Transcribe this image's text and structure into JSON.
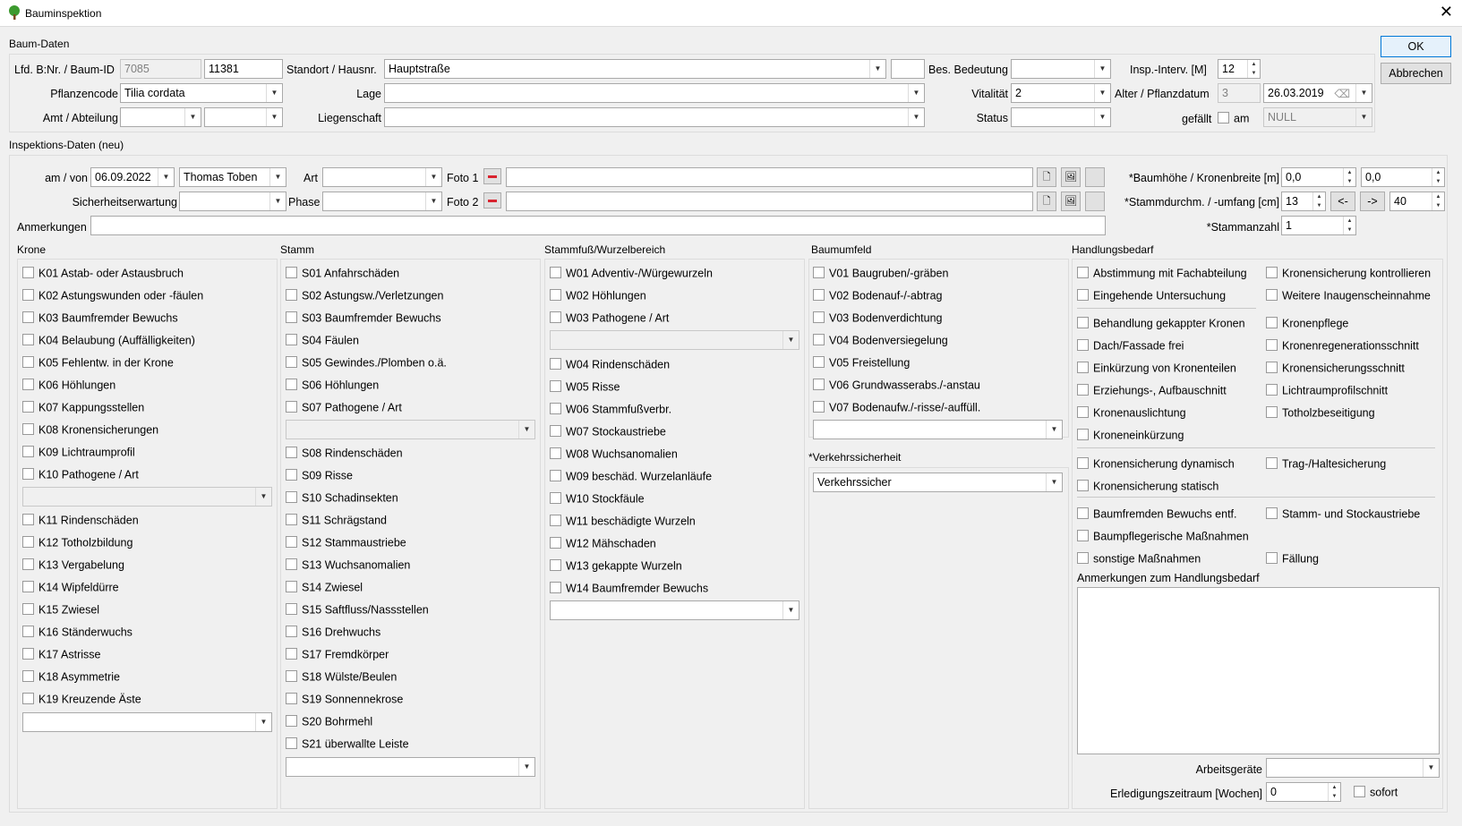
{
  "window": {
    "title": "Bauminspektion",
    "close": "✕"
  },
  "buttons": {
    "ok": "OK",
    "cancel": "Abbrechen"
  },
  "baum": {
    "section": "Baum-Daten",
    "lfd_label": "Lfd. B:Nr. / Baum-ID",
    "lfd_nr": "7085",
    "baum_id": "11381",
    "standort_label": "Standort / Hausnr.",
    "standort": "Hauptstraße",
    "hausnr": "",
    "bes_label": "Bes. Bedeutung",
    "bes": "",
    "insp_label": "Insp.-Interv. [M]",
    "insp": "12",
    "pflanz_label": "Pflanzencode",
    "pflanz": "Tilia cordata",
    "lage_label": "Lage",
    "lage": "",
    "vital_label": "Vitalität",
    "vital": "2",
    "alter_label": "Alter / Pflanzdatum",
    "alter": "3",
    "pflanzdatum": "26.03.2019",
    "amt_label": "Amt / Abteilung",
    "amt": "",
    "abteilung": "",
    "liegen_label": "Liegenschaft",
    "liegen": "",
    "status_label": "Status",
    "status": "",
    "gefaellt_label": "gefällt",
    "am_label": "am",
    "am_value": "NULL"
  },
  "insp": {
    "section": "Inspektions-Daten (neu)",
    "am_label": "am / von",
    "date": "06.09.2022",
    "inspector": "Thomas Toben",
    "art_label": "Art",
    "art": "",
    "foto1_label": "Foto 1",
    "foto1": "",
    "foto2_label": "Foto 2",
    "foto2": "",
    "sicher_label": "Sicherheitserwartung",
    "sicher": "",
    "phase_label": "Phase",
    "phase": "",
    "anm_label": "Anmerkungen",
    "anm": "",
    "hoehe_label": "*Baumhöhe / Kronenbreite [m]",
    "hoehe": "0,0",
    "breite": "0,0",
    "stamm_label": "*Stammdurchm. / -umfang [cm]",
    "durchm": "13",
    "umfang": "40",
    "btn_left": "<-",
    "btn_right": "->",
    "anzahl_label": "*Stammanzahl",
    "anzahl": "1"
  },
  "krone": {
    "title": "Krone",
    "items": [
      "K01 Astab- oder Astausbruch",
      "K02 Astungswunden oder -fäulen",
      "K03 Baumfremder Bewuchs",
      "K04 Belaubung (Auffälligkeiten)",
      "K05 Fehlentw. in der Krone",
      "K06 Höhlungen",
      "K07 Kappungsstellen",
      "K08 Kronensicherungen",
      "K09 Lichtraumprofil",
      "K10 Pathogene / Art",
      "K11 Rindenschäden",
      "K12 Totholzbildung",
      "K13 Vergabelung",
      "K14 Wipfeldürre",
      "K15 Zwiesel",
      "K16 Ständerwuchs",
      "K17 Astrisse",
      "K18 Asymmetrie",
      "K19 Kreuzende Äste"
    ]
  },
  "stamm": {
    "title": "Stamm",
    "items": [
      "S01 Anfahrschäden",
      "S02 Astungsw./Verletzungen",
      "S03 Baumfremder Bewuchs",
      "S04 Fäulen",
      "S05 Gewindes./Plomben o.ä.",
      "S06 Höhlungen",
      "S07 Pathogene / Art",
      "S08 Rindenschäden",
      "S09 Risse",
      "S10 Schadinsekten",
      "S11 Schrägstand",
      "S12 Stammaustriebe",
      "S13 Wuchsanomalien",
      "S14 Zwiesel",
      "S15 Saftfluss/Nassstellen",
      "S16 Drehwuchs",
      "S17 Fremdkörper",
      "S18 Wülste/Beulen",
      "S19 Sonnennekrose",
      "S20 Bohrmehl",
      "S21 überwallte Leiste"
    ]
  },
  "wurzel": {
    "title": "Stammfuß/Wurzelbereich",
    "items": [
      "W01 Adventiv-/Würgewurzeln",
      "W02 Höhlungen",
      "W03 Pathogene / Art",
      "W04 Rindenschäden",
      "W05 Risse",
      "W06 Stammfußverbr.",
      "W07 Stockaustriebe",
      "W08 Wuchsanomalien",
      "W09 beschäd. Wurzelanläufe",
      "W10 Stockfäule",
      "W11 beschädigte Wurzeln",
      "W12 Mähschaden",
      "W13 gekappte Wurzeln",
      "W14 Baumfremder Bewuchs"
    ]
  },
  "umfeld": {
    "title": "Baumumfeld",
    "items": [
      "V01 Baugruben/-gräben",
      "V02 Bodenauf-/-abtrag",
      "V03 Bodenverdichtung",
      "V04 Bodenversiegelung",
      "V05 Freistellung",
      "V06 Grundwasserabs./-anstau",
      "V07 Bodenaufw./-risse/-auffüll."
    ],
    "verkehr_title": "*Verkehrssicherheit",
    "verkehr": "Verkehrssicher"
  },
  "handlung": {
    "title": "Handlungsbedarf",
    "left": [
      "Abstimmung mit Fachabteilung",
      "Eingehende Untersuchung",
      "Behandlung gekappter Kronen",
      "Dach/Fassade frei",
      "Einkürzung von Kronenteilen",
      "Erziehungs-, Aufbauschnitt",
      "Kronenauslichtung",
      "Kroneneinkürzung",
      "Kronensicherung dynamisch",
      "Kronensicherung statisch",
      "Baumfremden Bewuchs entf.",
      "Baumpflegerische Maßnahmen",
      "sonstige Maßnahmen"
    ],
    "right": [
      "Kronensicherung kontrollieren",
      "Weitere Inaugenscheinnahme",
      "Kronenpflege",
      "Kronenregenerationsschnitt",
      "Kronensicherungsschnitt",
      "Lichtraumprofilschnitt",
      "Totholzbeseitigung",
      "Trag-/Haltesicherung",
      "Stamm- und Stockaustriebe",
      "Fällung"
    ],
    "anm_label": "Anmerkungen zum Handlungsbedarf",
    "anm": "",
    "geraete_label": "Arbeitsgeräte",
    "geraete": "",
    "zeitraum_label": "Erledigungszeitraum [Wochen]",
    "zeitraum": "0",
    "sofort": "sofort"
  }
}
